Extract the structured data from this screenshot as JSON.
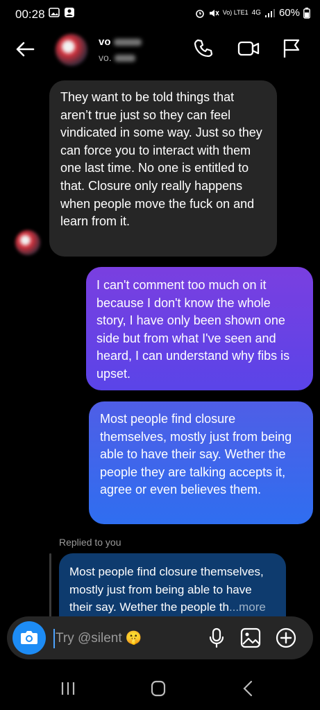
{
  "status_bar": {
    "time": "00:28",
    "network": "Vo) LTE1",
    "signal": "4G",
    "battery": "60%"
  },
  "header": {
    "name": "vo",
    "subtitle": "vo."
  },
  "messages": [
    {
      "sender": "other",
      "text": "They want to be told things that aren’t true just so they can feel vindicated in some way. Just so they can force you to interact with them one last time. No one is entitled to that. Closure only really happens when people move the fuck on and learn from it."
    },
    {
      "sender": "me",
      "text": "I can't comment too much on it because I don't know the whole story, I have only been shown one side but from what I've seen and heard, I can understand why fibs is upset."
    },
    {
      "sender": "me",
      "text": "Most people find closure themselves, mostly just from being able to have their say. Wether the people they are talking accepts it, agree or even believes them."
    }
  ],
  "reply": {
    "label": "Replied to you",
    "quote": "Most people find closure themselves, mostly just from being able to have their say. Wether the people th",
    "more": "...more"
  },
  "composer": {
    "placeholder": "Try @silent 🤫"
  },
  "icons": {
    "back": "arrow-left-icon",
    "call": "phone-icon",
    "video": "video-camera-icon",
    "flag": "flag-icon",
    "camera": "camera-icon",
    "mic": "microphone-icon",
    "gallery": "image-icon",
    "add": "plus-circle-icon"
  },
  "colors": {
    "accent": "#1d8cf5",
    "bubble_other": "#262626",
    "bubble_me_top": "#7a3fe0",
    "bubble_me_bottom": "#2f6ef0"
  }
}
